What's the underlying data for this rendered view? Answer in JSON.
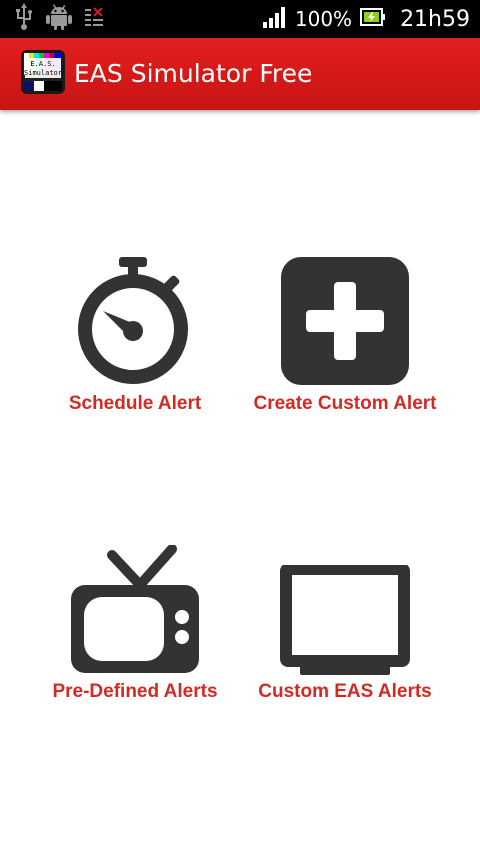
{
  "status_bar": {
    "battery_percent": "100%",
    "time": "21h59",
    "icons": [
      "usb-icon",
      "android-debug-icon",
      "sd-card-icon",
      "signal-icon",
      "battery-charging-icon"
    ]
  },
  "action_bar": {
    "title": "EAS Simulator Free",
    "icon_text_line1": "E.A.S.",
    "icon_text_line2": "Simulator"
  },
  "menu": {
    "schedule_alert": {
      "label": "Schedule Alert",
      "icon": "stopwatch-icon"
    },
    "create_custom_alert": {
      "label": "Create Custom Alert",
      "icon": "plus-square-icon"
    },
    "predefined_alerts": {
      "label": "Pre-Defined Alerts",
      "icon": "tv-icon"
    },
    "custom_eas_alerts": {
      "label": "Custom EAS Alerts",
      "icon": "monitor-icon"
    }
  },
  "colors": {
    "action_bar": "#d81a18",
    "label": "#d32a24",
    "icon": "#333333",
    "status_bar": "#000000"
  }
}
